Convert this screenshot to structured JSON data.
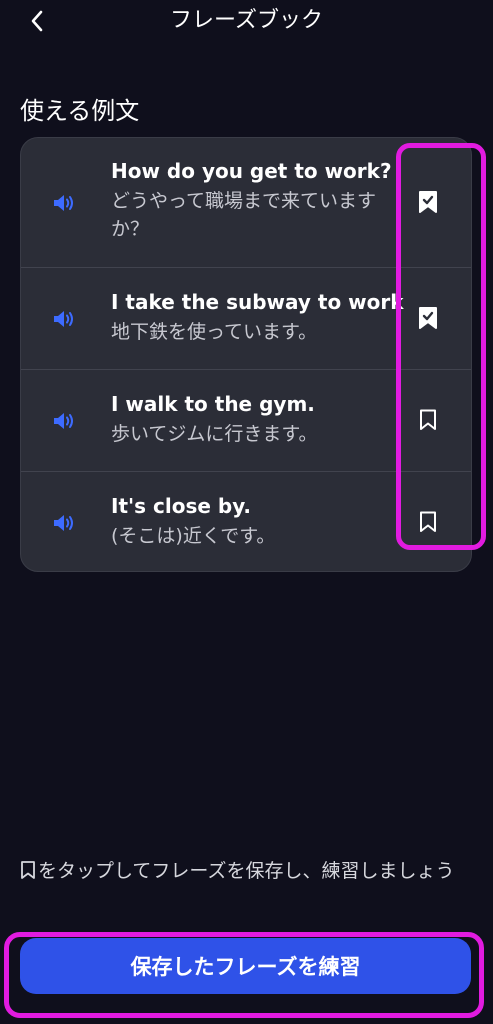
{
  "header": {
    "title": "フレーズブック",
    "back_icon": "chevron-left-icon"
  },
  "section": {
    "heading": "使える例文"
  },
  "phrases": [
    {
      "en": "How do you get to work?",
      "ja": "どうやって職場まで来ていますか？",
      "saved": true
    },
    {
      "en": "I take the subway to work.",
      "ja": "地下鉄を使っています。",
      "saved": true
    },
    {
      "en": "I walk to the gym.",
      "ja": "歩いてジムに行きます。",
      "saved": false
    },
    {
      "en": "It's close by.",
      "ja": "(そこは)近くです。",
      "saved": false
    }
  ],
  "hint": {
    "text": "をタップしてフレーズを保存し、練習しましょう"
  },
  "footer": {
    "practice_label": "保存したフレーズを練習"
  },
  "colors": {
    "background": "#0f0f1c",
    "card": "#2b2d37",
    "accent_blue": "#2f52e8",
    "speaker_blue": "#3d6bff",
    "annotation_magenta": "#e11be0"
  }
}
